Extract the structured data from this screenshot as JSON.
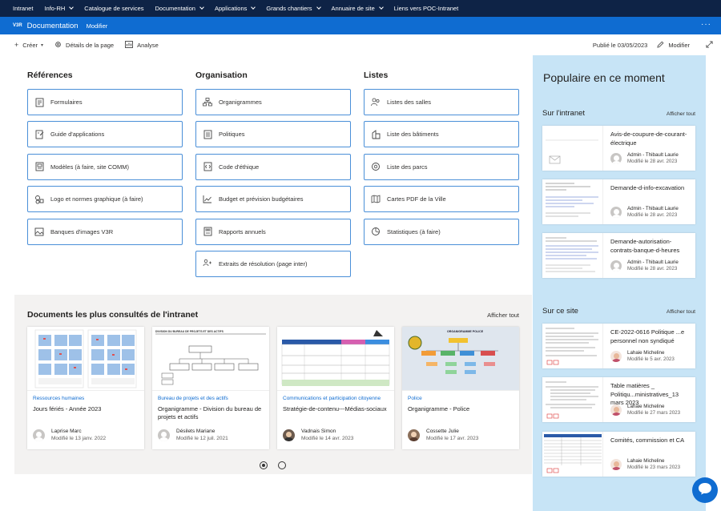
{
  "topnav": {
    "items": [
      {
        "label": "Intranet",
        "dropdown": false
      },
      {
        "label": "Info-RH",
        "dropdown": true
      },
      {
        "label": "Catalogue de services",
        "dropdown": false
      },
      {
        "label": "Documentation",
        "dropdown": true
      },
      {
        "label": "Applications",
        "dropdown": true
      },
      {
        "label": "Grands chantiers",
        "dropdown": true
      },
      {
        "label": "Annuaire de site",
        "dropdown": true
      },
      {
        "label": "Liens vers POC-Intranet",
        "dropdown": false
      }
    ]
  },
  "site": {
    "logo": "V3R",
    "title": "Documentation",
    "edit": "Modifier",
    "more": "···"
  },
  "commandbar": {
    "create": "Créer",
    "details": "Détails de la page",
    "analyse": "Analyse",
    "published": "Publié le 03/05/2023",
    "edit": "Modifier"
  },
  "sections": [
    {
      "title": "Références",
      "links": [
        {
          "label": "Formulaires",
          "icon": "form-icon"
        },
        {
          "label": "Guide d'applications",
          "icon": "guide-icon"
        },
        {
          "label": "Modèles (à faire, site COMM)",
          "icon": "template-icon"
        },
        {
          "label": "Logo et normes graphique (à faire)",
          "icon": "shapes-icon"
        },
        {
          "label": "Banques d'images V3R",
          "icon": "image-icon"
        }
      ]
    },
    {
      "title": "Organisation",
      "links": [
        {
          "label": "Organigrammes",
          "icon": "org-chart-icon"
        },
        {
          "label": "Politiques",
          "icon": "policy-icon"
        },
        {
          "label": "Code d'éthique",
          "icon": "code-icon"
        },
        {
          "label": "Budget et prévision budgétaires",
          "icon": "chart-icon"
        },
        {
          "label": "Rapports annuels",
          "icon": "report-icon"
        },
        {
          "label": "Extraits de résolution (page inter)",
          "icon": "resolution-icon"
        }
      ]
    },
    {
      "title": "Listes",
      "links": [
        {
          "label": "Listes des salles",
          "icon": "people-icon"
        },
        {
          "label": "Liste des bâtiments",
          "icon": "building-icon"
        },
        {
          "label": "Liste des parcs",
          "icon": "park-icon"
        },
        {
          "label": "Cartes PDF de la Ville",
          "icon": "map-icon"
        },
        {
          "label": "Statistiques (à faire)",
          "icon": "stats-icon"
        }
      ]
    }
  ],
  "documents": {
    "title": "Documents les plus consultés de l'intranet",
    "see_all": "Afficher tout",
    "cards": [
      {
        "category": "Ressources humaines",
        "title": "Jours fériés - Année 2023",
        "author": "Laprise Marc",
        "date": "Modifié le 13 janv. 2022",
        "thumb_caption": ""
      },
      {
        "category": "Bureau de projets et des actifs",
        "title": "Organigramme - Division du bureau de projets et actifs",
        "author": "Désilets Mariane",
        "date": "Modifié le 12 juil. 2021",
        "thumb_caption": "DIVISION DU BUREAU DE PROJETS ET DES ACTIFS"
      },
      {
        "category": "Communications et participation citoyenne",
        "title": "Stratégie-de-contenu---Médias-sociaux",
        "author": "Vadnais Simon",
        "date": "Modifié le 14 avr. 2023",
        "thumb_caption": ""
      },
      {
        "category": "Police",
        "title": "Organigramme - Police",
        "author": "Cossette Julie",
        "date": "Modifié le 17 avr. 2023",
        "thumb_caption": "ORGANIGRAMME POLICE"
      }
    ],
    "pager": {
      "current": 1,
      "total": 2
    }
  },
  "popular": {
    "title": "Populaire en ce moment",
    "intranet": {
      "heading": "Sur l'intranet",
      "see_all": "Afficher tout",
      "items": [
        {
          "title": "Avis-de-coupure-de-courant-électrique",
          "author": "Admin - Thibault Laurie",
          "date": "Modifié le 28 avr. 2023"
        },
        {
          "title": "Demande-d-info-excavation",
          "author": "Admin - Thibault Laurie",
          "date": "Modifié le 28 avr. 2023"
        },
        {
          "title": "Demande-autorisation-contrats-banque-d-heures",
          "author": "Admin - Thibault Laurie",
          "date": "Modifié le 28 avr. 2023"
        }
      ]
    },
    "site": {
      "heading": "Sur ce site",
      "see_all": "Afficher tout",
      "items": [
        {
          "title": "CE-2022-0616 Politique ...e personnel non syndiqué",
          "author": "Lahaie Micheline",
          "date": "Modifié le 5 avr. 2023"
        },
        {
          "title": "Table matières _ Politiqu...ministratives_13 mars 2023",
          "author": "Lahaie Micheline",
          "date": "Modifié le 27 mars 2023"
        },
        {
          "title": "Comités, commission et CA",
          "author": "Lahaie Micheline",
          "date": "Modifié le 23 mars 2023"
        }
      ]
    }
  },
  "colors": {
    "topnav": "#0e2346",
    "site_header": "#0f6cd1",
    "tile_border": "#4a8fd8",
    "panel": "#c7e4f6",
    "docs_bg": "#f3f2f1"
  }
}
